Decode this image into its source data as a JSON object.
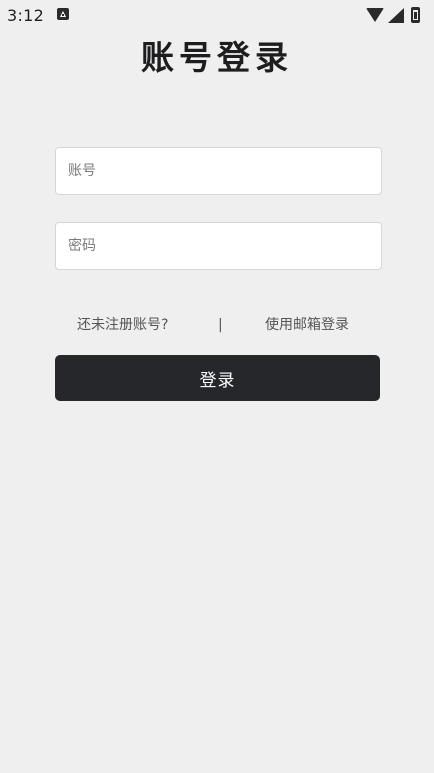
{
  "status_bar": {
    "time": "3:12",
    "icons": [
      "a-icon",
      "wifi-icon",
      "signal-icon",
      "battery-icon"
    ]
  },
  "page": {
    "title": "账号登录"
  },
  "form": {
    "account": {
      "placeholder": "账号",
      "value": ""
    },
    "password": {
      "placeholder": "密码",
      "value": ""
    }
  },
  "links": {
    "register": "还未注册账号?",
    "divider": "|",
    "email_login": "使用邮箱登录"
  },
  "actions": {
    "login_label": "登录"
  },
  "colors": {
    "background": "#efefef",
    "button": "#25272a",
    "button_text": "#ffffff",
    "field_border": "#d6d6d6"
  }
}
